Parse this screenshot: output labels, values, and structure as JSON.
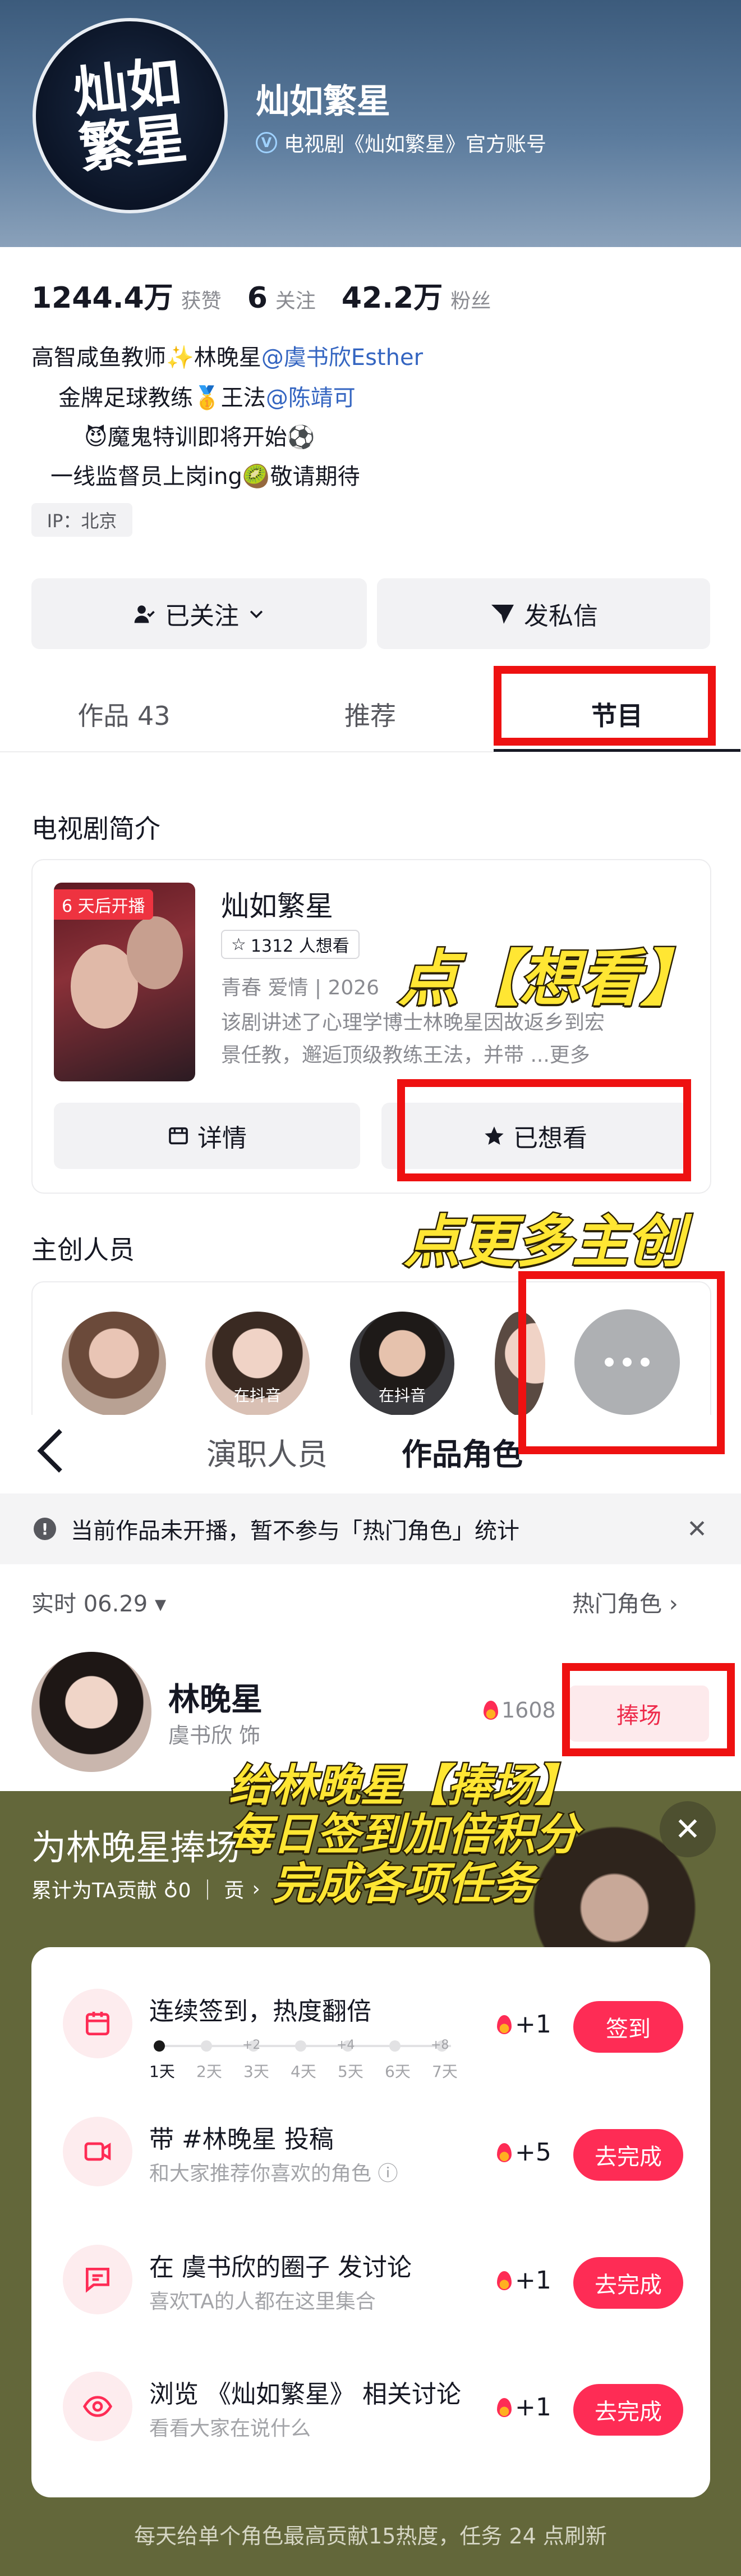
{
  "header": {
    "logo_text": "灿如繁星",
    "account_name": "灿如繁星",
    "verified_icon": "verified-icon",
    "account_desc": "电视剧《灿如繁星》官方账号"
  },
  "stats": [
    {
      "value": "1244.4万",
      "label": "获赞"
    },
    {
      "value": "6",
      "label": "关注"
    },
    {
      "value": "42.2万",
      "label": "粉丝"
    }
  ],
  "bio": {
    "line1_text": "高智咸鱼教师✨林晚星",
    "line1_mention": "@虞书欣Esther",
    "line2_text": "金牌足球教练🥇王法",
    "line2_mention": "@陈靖可",
    "line3": "😈魔鬼特训即将开始⚽",
    "line4": "一线监督员上岗ing🥝敬请期待",
    "ip": "IP：北京"
  },
  "actions": {
    "follow_label": "已关注",
    "message_label": "发私信"
  },
  "tabs": [
    {
      "label": "作品 43"
    },
    {
      "label": "推荐"
    },
    {
      "label": "节目"
    }
  ],
  "drama": {
    "section_title": "电视剧简介",
    "badge": "6 天后开播",
    "title": "灿如繁星",
    "want_count": "1312 人想看",
    "genre": "青春 爱情 | 2026",
    "desc_line1": "该剧讲述了心理学博士林晚星因故返乡到宏",
    "desc_line2": "景任教，邂逅顶级教练王法，并带 ...更多",
    "detail_label": "详情",
    "wanted_label": "已想看"
  },
  "annotations": {
    "want": "点【想看】",
    "more": "点更多主创",
    "task_line1": "给林晚星【捧场】",
    "task_line2": "每日签到加倍积分",
    "task_line3": "完成各项任务"
  },
  "cast": {
    "section_title": "主创人员",
    "tag": "在抖音"
  },
  "roles_panel": {
    "tab_cast": "演职人员",
    "tab_roles": "作品角色",
    "notice": "当前作品未开播，暂不参与「热门角色」统计",
    "realtime": "实时 06.29 ▾",
    "hot_roles": "热门角色 ›",
    "role_name": "林晚星",
    "role_actor": "虞书欣 饰",
    "heat": "1608",
    "support_label": "捧场"
  },
  "sheet": {
    "title": "为林晚星捧场",
    "contribution": "累计为TA贡献 ♁0 ｜ 贡",
    "tasks": [
      {
        "title": "连续签到，热度翻倍",
        "points": "+1",
        "button": "签到",
        "icon": "calendar-icon"
      },
      {
        "title": "带 #林晚星 投稿",
        "sub": "和大家推荐你喜欢的角色 ⓘ",
        "points": "+5",
        "button": "去完成",
        "icon": "video-icon"
      },
      {
        "title": "在 虞书欣的圈子 发讨论",
        "sub": "喜欢TA的人都在这里集合",
        "points": "+1",
        "button": "去完成",
        "icon": "chat-icon"
      },
      {
        "title": "浏览 《灿如繁星》 相关讨论",
        "sub": "看看大家在说什么",
        "points": "+1",
        "button": "去完成",
        "icon": "eye-icon"
      }
    ],
    "streak_days": [
      {
        "label": "1天",
        "bonus": ""
      },
      {
        "label": "2天",
        "bonus": ""
      },
      {
        "label": "3天",
        "bonus": "+2"
      },
      {
        "label": "4天",
        "bonus": ""
      },
      {
        "label": "5天",
        "bonus": "+4"
      },
      {
        "label": "6天",
        "bonus": ""
      },
      {
        "label": "7天",
        "bonus": "+8"
      }
    ],
    "footer": "每天给单个角色最高贡献15热度，任务 24 点刷新"
  },
  "colors": {
    "accent": "#fe2c55",
    "highlight_box": "#ee1111",
    "annotation": "#ffe633",
    "sheet_bg": "#63673a"
  }
}
